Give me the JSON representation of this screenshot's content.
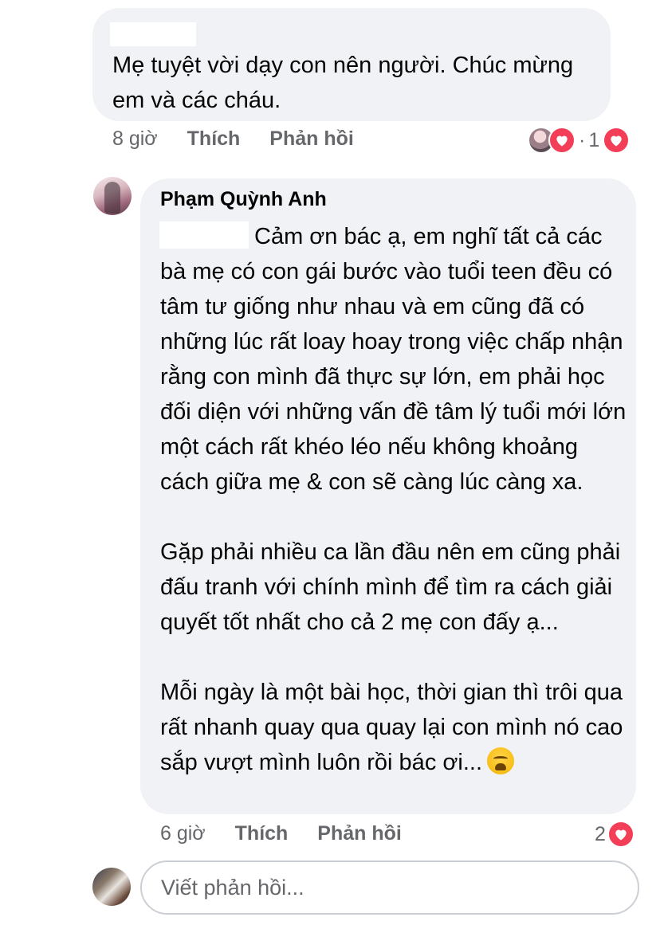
{
  "comment1": {
    "text": "Mẹ tuyệt vời dạy con nên người. Chúc mừng em và các cháu.",
    "time": "8 giờ",
    "like_label": "Thích",
    "reply_label": "Phản hồi",
    "reactions": {
      "separator": "·",
      "count": "1",
      "heart_color": "#f33e58"
    }
  },
  "reply": {
    "author": "Phạm Quỳnh Anh",
    "paragraphs": [
      "Cảm ơn bác ạ, em nghĩ tất cả các bà mẹ có con gái bước vào tuổi teen đều có tâm tư giống như nhau và em cũng đã có những lúc rất loay hoay trong việc chấp nhận rằng con mình đã thực sự lớn, em phải học đối diện với những vấn đề tâm lý tuổi mới lớn một cách rất khéo léo nếu không khoảng cách giữa mẹ & con sẽ càng lúc càng xa.",
      "Gặp phải nhiều ca lần đầu nên em cũng phải đấu tranh với chính mình để tìm ra cách giải quyết tốt nhất cho cả 2 mẹ con đấy ạ...",
      "Mỗi ngày là một bài học, thời gian thì trôi qua rất nhanh quay qua quay lại con mình nó cao sắp vượt mình luôn rồi bác ơi..."
    ],
    "emoji": "weary-face-icon",
    "time": "6 giờ",
    "like_label": "Thích",
    "reply_label": "Phản hồi",
    "reaction_count": "2"
  },
  "reply_box": {
    "placeholder": "Viết phản hồi..."
  },
  "colors": {
    "bubble": "#f0f2f5",
    "meta_text": "#65676b",
    "heart": "#f33e58"
  }
}
